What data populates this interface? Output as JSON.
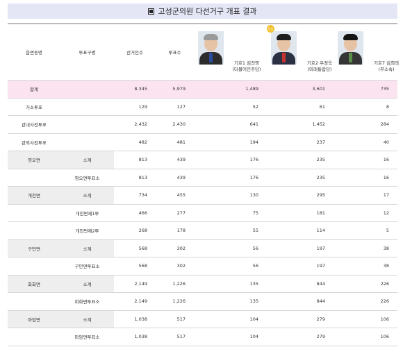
{
  "title": "고성군의원 다선거구 개표 결과",
  "headers": {
    "district": "읍면동명",
    "vote_type": "투표구명",
    "electors": "선거인수",
    "votes": "투표수"
  },
  "candidates": [
    {
      "number_name": "기호1 김진영",
      "party": "(더불어민주당)",
      "hair": "#9a9a9a",
      "suit": "#2c2c2c",
      "tie": "#2a4d9b"
    },
    {
      "number_name": "기호2 우정욱",
      "party": "(미래통합당)",
      "badge": "당선",
      "hair": "#1e1e1e",
      "suit": "#2b3142",
      "tie": "#c63232"
    },
    {
      "number_name": "기호7 김희태",
      "party": "(무소속)",
      "hair": "#151515",
      "suit": "#353535",
      "tie": "#5c8c4a"
    }
  ],
  "rows": [
    {
      "district": "합계",
      "vote_type": "",
      "electors": "8,345",
      "votes": "5,979",
      "c1": "1,489",
      "c2": "3,601",
      "c3": "735",
      "kind": "total"
    },
    {
      "district": "거소투표",
      "vote_type": "",
      "electors": "129",
      "votes": "127",
      "c1": "52",
      "c2": "61",
      "c3": "8",
      "kind": "plain"
    },
    {
      "district": "관내사전투표",
      "vote_type": "",
      "electors": "2,432",
      "votes": "2,430",
      "c1": "641",
      "c2": "1,452",
      "c3": "284",
      "kind": "plain"
    },
    {
      "district": "관외사전투표",
      "vote_type": "",
      "electors": "482",
      "votes": "481",
      "c1": "194",
      "c2": "237",
      "c3": "40",
      "kind": "plain"
    },
    {
      "district": "영오면",
      "vote_type": "소계",
      "electors": "813",
      "votes": "439",
      "c1": "176",
      "c2": "235",
      "c3": "16",
      "kind": "sub"
    },
    {
      "district": "",
      "vote_type": "영오면투표소",
      "electors": "813",
      "votes": "439",
      "c1": "176",
      "c2": "235",
      "c3": "16",
      "kind": "plain"
    },
    {
      "district": "개천면",
      "vote_type": "소계",
      "electors": "734",
      "votes": "455",
      "c1": "130",
      "c2": "295",
      "c3": "17",
      "kind": "sub"
    },
    {
      "district": "",
      "vote_type": "개천면제1투",
      "electors": "466",
      "votes": "277",
      "c1": "75",
      "c2": "181",
      "c3": "12",
      "kind": "plain"
    },
    {
      "district": "",
      "vote_type": "개천면제2투",
      "electors": "268",
      "votes": "178",
      "c1": "55",
      "c2": "114",
      "c3": "5",
      "kind": "plain"
    },
    {
      "district": "구만면",
      "vote_type": "소계",
      "electors": "568",
      "votes": "302",
      "c1": "56",
      "c2": "197",
      "c3": "38",
      "kind": "sub"
    },
    {
      "district": "",
      "vote_type": "구만면투표소",
      "electors": "568",
      "votes": "302",
      "c1": "56",
      "c2": "197",
      "c3": "38",
      "kind": "plain"
    },
    {
      "district": "회화면",
      "vote_type": "소계",
      "electors": "2,149",
      "votes": "1,226",
      "c1": "135",
      "c2": "844",
      "c3": "226",
      "kind": "sub"
    },
    {
      "district": "",
      "vote_type": "회화면투표소",
      "electors": "2,149",
      "votes": "1,226",
      "c1": "135",
      "c2": "844",
      "c3": "226",
      "kind": "plain"
    },
    {
      "district": "마암면",
      "vote_type": "소계",
      "electors": "1,038",
      "votes": "517",
      "c1": "104",
      "c2": "279",
      "c3": "106",
      "kind": "sub"
    },
    {
      "district": "",
      "vote_type": "마암면투표소",
      "electors": "1,038",
      "votes": "517",
      "c1": "104",
      "c2": "279",
      "c3": "106",
      "kind": "plain"
    }
  ],
  "colors": {
    "title_bg": "#e4e6f6",
    "total_bg": "#fbe4ef",
    "subtotal_bg": "#eeeeee"
  }
}
